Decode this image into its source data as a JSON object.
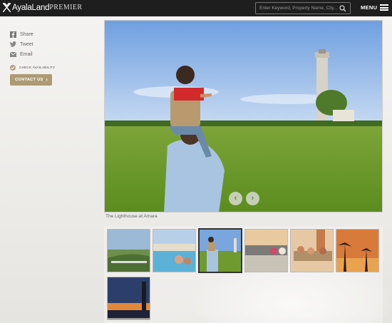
{
  "header": {
    "logo_text": "AyalaLand",
    "logo_sub": "PREMIER",
    "search_placeholder": "Enter Keyword, Property Name, City...",
    "menu_label": "MENU"
  },
  "sidebar": {
    "share_links": [
      {
        "label": "Share",
        "icon": "facebook-icon"
      },
      {
        "label": "Tweet",
        "icon": "twitter-icon"
      },
      {
        "label": "Email",
        "icon": "email-icon"
      }
    ],
    "check_availability": "CHECK AVAILABILITY",
    "contact_button": "CONTACT US"
  },
  "gallery": {
    "caption": "The Lighthouse at Amara",
    "thumbnail_count": 7,
    "selected_index": 2
  },
  "colors": {
    "accent": "#ad9b74",
    "topbar": "#1e1e1e"
  }
}
